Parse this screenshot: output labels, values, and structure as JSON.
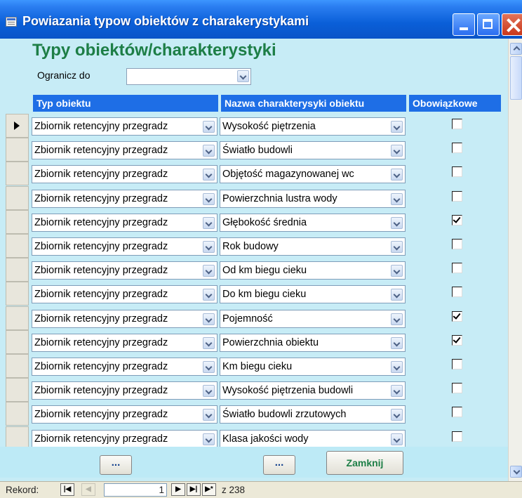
{
  "window": {
    "title": "Powiazania typow obiektów z charakerystykami"
  },
  "form": {
    "title": "Typy obiektów/charakterystyki",
    "filter": {
      "label": "Ogranicz do",
      "value": ""
    },
    "columns": {
      "typ": "Typ obiektu",
      "nazwa": "Nazwa charakterysyki obiektu",
      "obowiazkowe": "Obowiązkowe"
    }
  },
  "rows": [
    {
      "typ": "Zbiornik retencyjny przegradz",
      "nazwa": "Wysokość piętrzenia",
      "obowiazkowe": false,
      "current": true
    },
    {
      "typ": "Zbiornik retencyjny przegradz",
      "nazwa": "Światło budowli",
      "obowiazkowe": false
    },
    {
      "typ": "Zbiornik retencyjny przegradz",
      "nazwa": "Objętość magazynowanej wc",
      "obowiazkowe": false
    },
    {
      "typ": "Zbiornik retencyjny przegradz",
      "nazwa": "Powierzchnia lustra wody",
      "obowiazkowe": false
    },
    {
      "typ": "Zbiornik retencyjny przegradz",
      "nazwa": "Głębokość średnia",
      "obowiazkowe": true
    },
    {
      "typ": "Zbiornik retencyjny przegradz",
      "nazwa": "Rok budowy",
      "obowiazkowe": false
    },
    {
      "typ": "Zbiornik retencyjny przegradz",
      "nazwa": "Od km biegu cieku",
      "obowiazkowe": false
    },
    {
      "typ": "Zbiornik retencyjny przegradz",
      "nazwa": "Do km biegu cieku",
      "obowiazkowe": false
    },
    {
      "typ": "Zbiornik retencyjny przegradz",
      "nazwa": "Pojemność",
      "obowiazkowe": true
    },
    {
      "typ": "Zbiornik retencyjny przegradz",
      "nazwa": "Powierzchnia obiektu",
      "obowiazkowe": true
    },
    {
      "typ": "Zbiornik retencyjny przegradz",
      "nazwa": "Km biegu cieku",
      "obowiazkowe": false
    },
    {
      "typ": "Zbiornik retencyjny przegradz",
      "nazwa": "Wysokość piętrzenia budowli",
      "obowiazkowe": false
    },
    {
      "typ": "Zbiornik retencyjny przegradz",
      "nazwa": "Światło budowli zrzutowych",
      "obowiazkowe": false
    },
    {
      "typ": "Zbiornik retencyjny przegradz",
      "nazwa": "Klasa jakości wody",
      "obowiazkowe": false
    }
  ],
  "footer": {
    "button1": "...",
    "button2": "...",
    "close": "Zamknij"
  },
  "navigation": {
    "label": "Rekord:",
    "current": "1",
    "total": "z 238"
  }
}
